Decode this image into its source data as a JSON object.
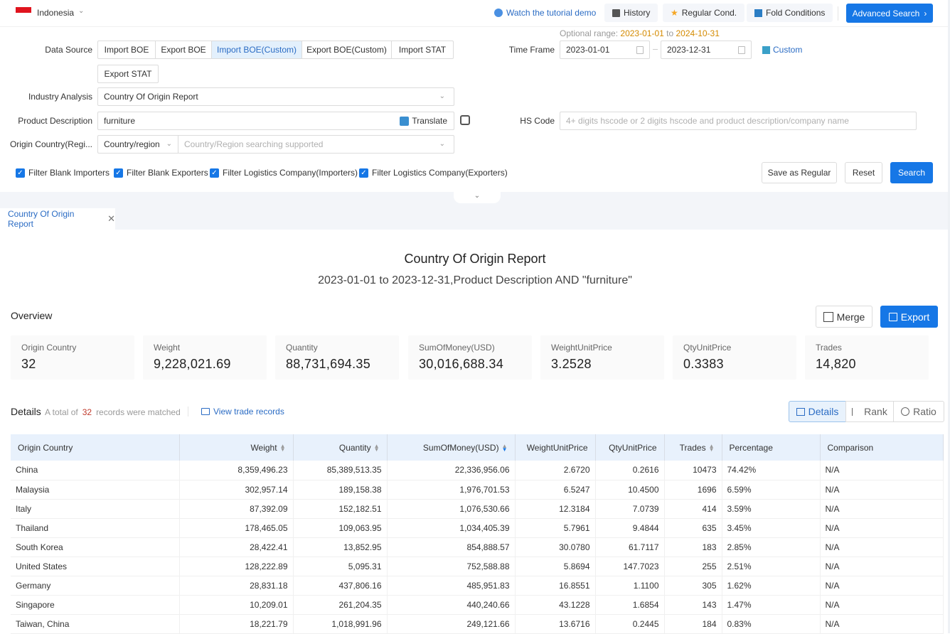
{
  "topbar": {
    "country": "Indonesia",
    "tutorial": "Watch the tutorial demo",
    "history": "History",
    "regular_cond": "Regular Cond.",
    "fold_conditions": "Fold Conditions",
    "advanced_search": "Advanced Search"
  },
  "form": {
    "data_source_label": "Data Source",
    "data_sources": [
      "Import BOE",
      "Export BOE",
      "Import BOE(Custom)",
      "Export BOE(Custom)",
      "Import STAT",
      "Export STAT"
    ],
    "data_source_selected": "Import BOE(Custom)",
    "optional_range_label": "Optional range:",
    "optional_from": "2023-01-01",
    "optional_to_word": "to",
    "optional_to": "2024-10-31",
    "time_frame_label": "Time Frame",
    "date_from": "2023-01-01",
    "date_to": "2023-12-31",
    "custom": "Custom",
    "industry_label": "Industry Analysis",
    "industry_value": "Country Of Origin Report",
    "product_label": "Product Description",
    "product_value": "furniture",
    "translate": "Translate",
    "hs_label": "HS Code",
    "hs_placeholder": "4+ digits hscode or 2 digits hscode and product description/company name",
    "origin_label": "Origin Country(Regi...",
    "origin_type": "Country/region",
    "origin_placeholder": "Country/Region searching supported",
    "filters": [
      {
        "label": "Filter Blank Importers",
        "checked": true
      },
      {
        "label": "Filter Blank Exporters",
        "checked": true
      },
      {
        "label": "Filter Logistics Company(Importers)",
        "checked": true
      },
      {
        "label": "Filter Logistics Company(Exporters)",
        "checked": true
      }
    ],
    "save_regular": "Save as Regular",
    "reset": "Reset",
    "search": "Search"
  },
  "tab": {
    "label": "Country Of Origin Report"
  },
  "report": {
    "title": "Country Of Origin Report",
    "subtitle": "2023-01-01 to 2023-12-31,Product Description AND \"furniture\"",
    "overview_label": "Overview",
    "merge": "Merge",
    "export": "Export",
    "cards": [
      {
        "label": "Origin Country",
        "value": "32"
      },
      {
        "label": "Weight",
        "value": "9,228,021.69"
      },
      {
        "label": "Quantity",
        "value": "88,731,694.35"
      },
      {
        "label": "SumOfMoney(USD)",
        "value": "30,016,688.34"
      },
      {
        "label": "WeightUnitPrice",
        "value": "3.2528"
      },
      {
        "label": "QtyUnitPrice",
        "value": "0.3383"
      },
      {
        "label": "Trades",
        "value": "14,820"
      }
    ],
    "details_label": "Details",
    "total_prefix": "A total of",
    "total_count": "32",
    "total_suffix": "records were matched",
    "view_trade_records": "View trade records",
    "views": [
      "Details",
      "Rank",
      "Ratio"
    ],
    "view_selected": "Details"
  },
  "table": {
    "headers": [
      "Origin Country",
      "Weight",
      "Quantity",
      "SumOfMoney(USD)",
      "WeightUnitPrice",
      "QtyUnitPrice",
      "Trades",
      "Percentage",
      "Comparison"
    ],
    "rows": [
      [
        "China",
        "8,359,496.23",
        "85,389,513.35",
        "22,336,956.06",
        "2.6720",
        "0.2616",
        "10473",
        "74.42%",
        "N/A"
      ],
      [
        "Malaysia",
        "302,957.14",
        "189,158.38",
        "1,976,701.53",
        "6.5247",
        "10.4500",
        "1696",
        "6.59%",
        "N/A"
      ],
      [
        "Italy",
        "87,392.09",
        "152,182.51",
        "1,076,530.66",
        "12.3184",
        "7.0739",
        "414",
        "3.59%",
        "N/A"
      ],
      [
        "Thailand",
        "178,465.05",
        "109,063.95",
        "1,034,405.39",
        "5.7961",
        "9.4844",
        "635",
        "3.45%",
        "N/A"
      ],
      [
        "South Korea",
        "28,422.41",
        "13,852.95",
        "854,888.57",
        "30.0780",
        "61.7117",
        "183",
        "2.85%",
        "N/A"
      ],
      [
        "United States",
        "128,222.89",
        "5,095.31",
        "752,588.88",
        "5.8694",
        "147.7023",
        "255",
        "2.51%",
        "N/A"
      ],
      [
        "Germany",
        "28,831.18",
        "437,806.16",
        "485,951.83",
        "16.8551",
        "1.1100",
        "305",
        "1.62%",
        "N/A"
      ],
      [
        "Singapore",
        "10,209.01",
        "261,204.35",
        "440,240.66",
        "43.1228",
        "1.6854",
        "143",
        "1.47%",
        "N/A"
      ],
      [
        "Taiwan, China",
        "18,221.79",
        "1,018,991.96",
        "249,121.66",
        "13.6716",
        "0.2445",
        "184",
        "0.83%",
        "N/A"
      ]
    ]
  }
}
